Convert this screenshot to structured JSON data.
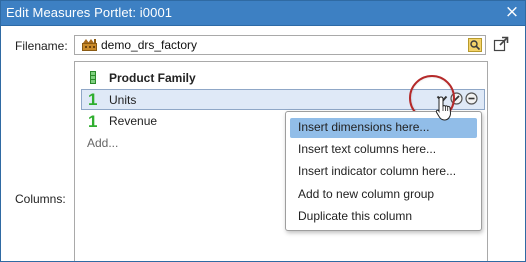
{
  "window": {
    "title": "Edit Measures Portlet: i0001",
    "close_glyph": "×"
  },
  "filename": {
    "label": "Filename:",
    "value": "demo_drs_factory",
    "icons": [
      "cube-icon",
      "browse-icon",
      "popout-icon"
    ]
  },
  "columns": {
    "label": "Columns:",
    "family": {
      "label": "Product Family",
      "icon": "dimension-icon"
    },
    "rows": [
      {
        "label": "Units",
        "icon_text": "1",
        "selected": true
      },
      {
        "label": "Revenue",
        "icon_text": "1",
        "selected": false
      }
    ],
    "add_label": "Add...",
    "row_action_icons": [
      "dropdown-chevron-icon",
      "edit-icon",
      "remove-icon"
    ]
  },
  "context_menu": {
    "items": [
      {
        "label": "Insert dimensions here...",
        "active": true
      },
      {
        "label": "Insert text columns here...",
        "active": false
      },
      {
        "label": "Insert indicator column here...",
        "active": false
      },
      {
        "label": "Add to new column group",
        "active": false
      },
      {
        "label": "Duplicate this column",
        "active": false
      }
    ]
  },
  "colors": {
    "titlebar": "#3d80c3",
    "selected_row": "#dfe9f7",
    "menu_highlight": "#91bde8",
    "measure_icon": "#2fae2f",
    "highlight_ring": "#b52a2a"
  }
}
